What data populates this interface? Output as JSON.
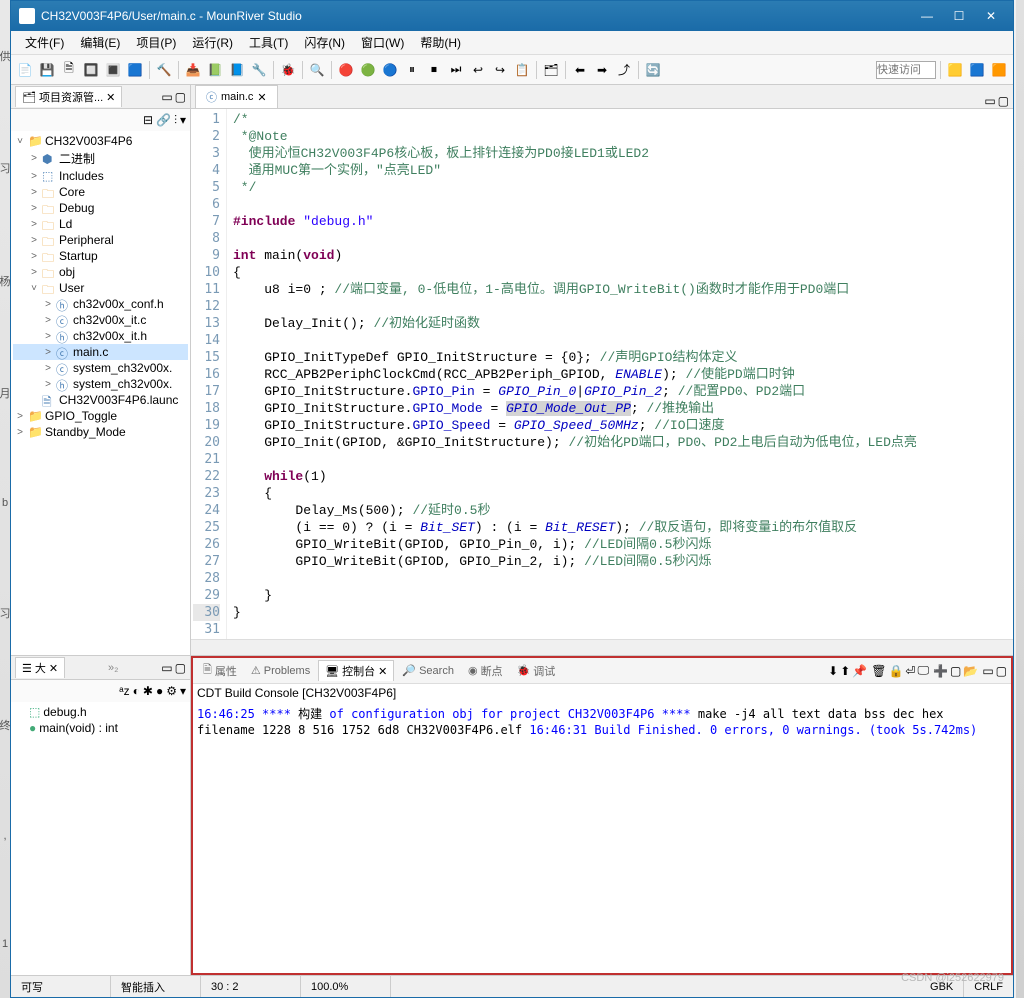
{
  "title": "CH32V003F4P6/User/main.c - MounRiver Studio",
  "menubar": [
    "文件(F)",
    "编辑(E)",
    "项目(P)",
    "运行(R)",
    "工具(T)",
    "闪存(N)",
    "窗口(W)",
    "帮助(H)"
  ],
  "toolbar": {
    "quick_access": "快速访问"
  },
  "project_explorer": {
    "tab_label": "项目资源管...",
    "items": [
      {
        "depth": 0,
        "exp": "˅",
        "icon": "proj",
        "label": "CH32V003F4P6"
      },
      {
        "depth": 1,
        "exp": ">",
        "icon": "bin",
        "label": "二进制"
      },
      {
        "depth": 1,
        "exp": ">",
        "icon": "inc",
        "label": "Includes"
      },
      {
        "depth": 1,
        "exp": ">",
        "icon": "folder",
        "label": "Core"
      },
      {
        "depth": 1,
        "exp": ">",
        "icon": "folder",
        "label": "Debug"
      },
      {
        "depth": 1,
        "exp": ">",
        "icon": "folder",
        "label": "Ld"
      },
      {
        "depth": 1,
        "exp": ">",
        "icon": "folder",
        "label": "Peripheral"
      },
      {
        "depth": 1,
        "exp": ">",
        "icon": "folder",
        "label": "Startup"
      },
      {
        "depth": 1,
        "exp": ">",
        "icon": "folder",
        "label": "obj"
      },
      {
        "depth": 1,
        "exp": "˅",
        "icon": "folder",
        "label": "User"
      },
      {
        "depth": 2,
        "exp": ">",
        "icon": "h",
        "label": "ch32v00x_conf.h"
      },
      {
        "depth": 2,
        "exp": ">",
        "icon": "c",
        "label": "ch32v00x_it.c"
      },
      {
        "depth": 2,
        "exp": ">",
        "icon": "h",
        "label": "ch32v00x_it.h"
      },
      {
        "depth": 2,
        "exp": ">",
        "icon": "c",
        "label": "main.c",
        "sel": true
      },
      {
        "depth": 2,
        "exp": ">",
        "icon": "c",
        "label": "system_ch32v00x."
      },
      {
        "depth": 2,
        "exp": ">",
        "icon": "h",
        "label": "system_ch32v00x."
      },
      {
        "depth": 1,
        "exp": "",
        "icon": "file",
        "label": "CH32V003F4P6.launc"
      },
      {
        "depth": 0,
        "exp": ">",
        "icon": "proj",
        "label": "GPIO_Toggle"
      },
      {
        "depth": 0,
        "exp": ">",
        "icon": "proj",
        "label": "Standby_Mode"
      }
    ]
  },
  "editor": {
    "tab": "main.c",
    "gutter_start": 1,
    "gutter_end": 31,
    "comment1": "/*",
    "comment2": " *@Note",
    "comment3": "  使用沁恒CH32V003F4P6核心板，板上排针连接为PD0接LED1或LED2",
    "comment4": "  通用MUC第一个实例，\"点亮LED\"",
    "comment5": " */",
    "inc1": "#include ",
    "inc2": "\"debug.h\"",
    "main1": "int",
    "main2": " main(",
    "main3": "void",
    "main4": ")",
    "brace_open": "{",
    "l10a": "    u8 i=0 ; ",
    "l10b": "//端口变量, 0-低电位，1-高电位。调用GPIO_WriteBit()函数时才能作用于PD0端口",
    "l12a": "    Delay_Init(); ",
    "l12b": "//初始化延时函数",
    "l14a": "    GPIO_InitTypeDef GPIO_InitStructure = {0}; ",
    "l14b": "//声明GPIO结构体定义",
    "l15a": "    RCC_APB2PeriphClockCmd(RCC_APB2Periph_GPIOD, ",
    "l15c": "ENABLE",
    "l15d": "); ",
    "l15b": "//使能PD端口时钟",
    "l16a": "    GPIO_InitStructure.",
    "l16f": "GPIO_Pin",
    "l16b": " = ",
    "l16c": "GPIO_Pin_0",
    "l16d": "|",
    "l16e": "GPIO_Pin_2",
    "l16g": "; ",
    "l16h": "//配置PD0、PD2端口",
    "l17a": "    GPIO_InitStructure.",
    "l17f": "GPIO_Mode",
    "l17b": " = ",
    "l17c": "GPIO_Mode_Out_PP",
    "l17d": "; ",
    "l17e": "//推挽输出",
    "l18a": "    GPIO_InitStructure.",
    "l18f": "GPIO_Speed",
    "l18b": " = ",
    "l18c": "GPIO_Speed_50MHz",
    "l18d": "; ",
    "l18e": "//IO口速度",
    "l19a": "    GPIO_Init(GPIOD, &GPIO_InitStructure); ",
    "l19b": "//初始化PD端口，PD0、PD2上电后自动为低电位，LED点亮",
    "l21a": "    ",
    "l21b": "while",
    "l21c": "(1)",
    "l22": "    {",
    "l23a": "        Delay_Ms(500); ",
    "l23b": "//延时0.5秒",
    "l24a": "        (i == 0) ? (i = ",
    "l24b": "Bit_SET",
    "l24c": ") : (i = ",
    "l24d": "Bit_RESET",
    "l24e": "); ",
    "l24f": "//取反语句，即将变量i的布尔值取反",
    "l25a": "        GPIO_WriteBit(GPIOD, GPIO_Pin_0, i); ",
    "l25b": "//LED间隔0.5秒闪烁",
    "l26a": "        GPIO_WriteBit(GPIOD, GPIO_Pin_2, i); ",
    "l26b": "//LED间隔0.5秒闪烁",
    "l28": "    }",
    "brace_close": "}"
  },
  "outline": {
    "tab_label": "大",
    "items": [
      {
        "icon": "inc",
        "label": "debug.h"
      },
      {
        "icon": "func",
        "label": "main(void) : int"
      }
    ]
  },
  "console": {
    "tabs": [
      "属性",
      "Problems",
      "控制台",
      "Search",
      "断点",
      "调试"
    ],
    "active_tab": 2,
    "title": "CDT Build Console [CH32V003F4P6]",
    "line1a": "16:46:25 **** ",
    "line1b": "构建 ",
    "line1c": "of configuration obj for project CH32V003F4P6 ****",
    "line2": "make -j4 all",
    "line3": "   text\t   data\t    bss\t    dec\t    hex\tfilename",
    "line4": "   1228\t      8\t    516\t   1752\t    6d8\tCH32V003F4P6.elf",
    "line5": "",
    "line6": "16:46:31 Build Finished. 0 errors, 0 warnings. (took 5s.742ms)"
  },
  "statusbar": {
    "writable": "可写",
    "insert": "智能插入",
    "cursor": "30 : 2",
    "zoom": "100.0%",
    "encoding": "GBK",
    "lineend": "CRLF"
  },
  "watermark": "CSDN @i252622979"
}
